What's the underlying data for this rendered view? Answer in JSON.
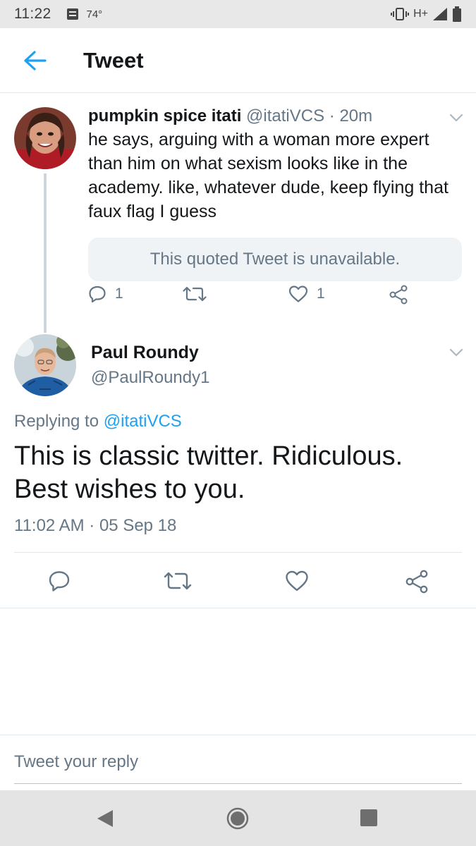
{
  "status_bar": {
    "time": "11:22",
    "temperature": "74°",
    "network": "H+"
  },
  "header": {
    "title": "Tweet"
  },
  "parent_tweet": {
    "name": "pumpkin spice itati",
    "handle": "@itatiVCS",
    "separator": "·",
    "age": "20m",
    "text": "he says, arguing with a woman more expert than him on what sexism looks like in the academy. like, whatever dude, keep flying that faux flag I guess",
    "quoted_unavailable": "This quoted Tweet is unavailable.",
    "reply_count": "1",
    "like_count": "1"
  },
  "reply_tweet": {
    "name": "Paul Roundy",
    "handle": "@PaulRoundy1",
    "replying_prefix": "Replying to",
    "replying_handle": "@itatiVCS",
    "text": "This is classic twitter. Ridiculous. Best wishes to you.",
    "timestamp": "11:02 AM · 05 Sep 18"
  },
  "compose": {
    "placeholder": "Tweet your reply"
  },
  "colors": {
    "accent": "#1da1f2",
    "muted": "#657786",
    "text": "#14171a",
    "border": "#e1e8ed"
  },
  "icons": [
    "back-arrow-icon",
    "reply-icon",
    "retweet-icon",
    "like-icon",
    "share-icon",
    "chevron-down-icon",
    "nav-back-icon",
    "nav-home-icon",
    "nav-recents-icon"
  ]
}
